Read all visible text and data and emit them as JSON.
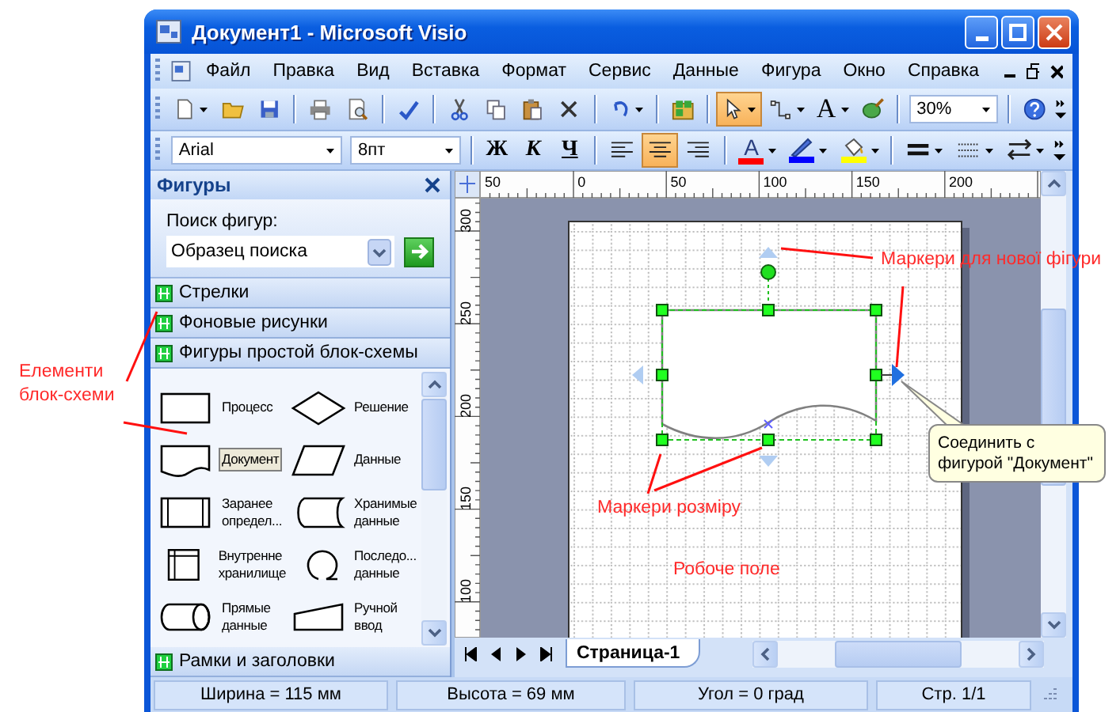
{
  "window": {
    "title": "Документ1 - Microsoft Visio"
  },
  "menu": [
    "Файл",
    "Правка",
    "Вид",
    "Вставка",
    "Формат",
    "Сервис",
    "Данные",
    "Фигура",
    "Окно",
    "Справка"
  ],
  "toolbar1": {
    "groups": [
      [
        {
          "kind": "new",
          "dropdown": true,
          "selected": false
        },
        {
          "kind": "open",
          "dropdown": false,
          "selected": false
        },
        {
          "kind": "save",
          "dropdown": false,
          "selected": false
        }
      ],
      [
        {
          "kind": "print",
          "dropdown": false,
          "selected": false
        },
        {
          "kind": "preview",
          "dropdown": false,
          "selected": false
        }
      ],
      [
        {
          "kind": "spelling",
          "dropdown": false,
          "selected": false
        }
      ],
      [
        {
          "kind": "cut",
          "dropdown": false,
          "selected": false
        },
        {
          "kind": "copy",
          "dropdown": false,
          "selected": false
        },
        {
          "kind": "paste",
          "dropdown": false,
          "selected": false
        },
        {
          "kind": "delete",
          "dropdown": false,
          "selected": false
        }
      ],
      [
        {
          "kind": "undo",
          "dropdown": true,
          "selected": false
        }
      ],
      [
        {
          "kind": "shapes",
          "dropdown": false,
          "selected": false
        }
      ],
      [
        {
          "kind": "pointer",
          "dropdown": true,
          "selected": true
        },
        {
          "kind": "connector",
          "dropdown": true,
          "selected": false
        },
        {
          "kind": "text",
          "label": "A",
          "dropdown": true,
          "selected": false
        },
        {
          "kind": "format-painter",
          "dropdown": false,
          "selected": false
        }
      ],
      [
        {
          "kind": "zoom",
          "value": "30%"
        }
      ],
      [
        {
          "kind": "help",
          "dropdown": false,
          "selected": false
        }
      ]
    ]
  },
  "toolbar2": {
    "groups": [
      [
        {
          "kind": "font",
          "value": "Arial"
        },
        {
          "kind": "size",
          "value": "8пт"
        }
      ],
      [
        {
          "kind": "bold",
          "label": "Ж",
          "dropdown": false,
          "selected": false
        },
        {
          "kind": "italic",
          "label": "К",
          "dropdown": false,
          "selected": false
        },
        {
          "kind": "underline",
          "label": "Ч",
          "dropdown": false,
          "selected": false
        }
      ],
      [
        {
          "kind": "align-left",
          "dropdown": false,
          "selected": false
        },
        {
          "kind": "align-center",
          "dropdown": false,
          "selected": true
        },
        {
          "kind": "align-right",
          "dropdown": false,
          "selected": false
        }
      ],
      [
        {
          "kind": "font-color",
          "label": "A",
          "color": "#ff0000",
          "dropdown": true,
          "selected": false
        },
        {
          "kind": "line-color",
          "color": "#0000ff",
          "dropdown": true,
          "selected": false
        },
        {
          "kind": "fill-color",
          "color": "#ffff00",
          "dropdown": true,
          "selected": false
        }
      ],
      [
        {
          "kind": "line-weight",
          "dropdown": true,
          "selected": false
        },
        {
          "kind": "line-pattern",
          "dropdown": true,
          "selected": false
        },
        {
          "kind": "line-ends",
          "dropdown": true,
          "selected": false
        }
      ]
    ]
  },
  "shapes_panel": {
    "title": "Фигуры",
    "search": {
      "label": "Поиск фигур:",
      "value": "Образец поиска"
    },
    "categories": [
      {
        "label": "Стрелки"
      },
      {
        "label": "Фоновые рисунки"
      },
      {
        "label": "Фигуры простой блок-схемы"
      }
    ],
    "stencil": [
      {
        "kind": "process",
        "label": "Процесс",
        "selected": false
      },
      {
        "kind": "decision",
        "label": "Решение",
        "selected": false
      },
      {
        "kind": "document",
        "label": "Документ",
        "selected": true
      },
      {
        "kind": "data",
        "label": "Данные",
        "selected": false
      },
      {
        "kind": "predefined",
        "label": "Заранее\nопредел...",
        "selected": false
      },
      {
        "kind": "stored",
        "label": "Хранимые\nданные",
        "selected": false
      },
      {
        "kind": "internal",
        "label": "Внутренне\nхранилище",
        "selected": false
      },
      {
        "kind": "sequential",
        "label": "Последо...\nданные",
        "selected": false
      },
      {
        "kind": "direct",
        "label": "Прямые\nданные",
        "selected": false
      },
      {
        "kind": "manual",
        "label": "Ручной\nввод",
        "selected": false
      }
    ],
    "categories_bottom": [
      {
        "label": "Рамки и заголовки"
      }
    ]
  },
  "canvas": {
    "top_ruler": [
      "50",
      "0",
      "50",
      "100",
      "150",
      "200"
    ],
    "left_ruler": [
      "300",
      "250",
      "200",
      "150",
      "100"
    ],
    "page_tabs": [
      {
        "label": "Страница-1",
        "selected": true
      }
    ]
  },
  "tooltip": {
    "text": "Соединить с\nфигурой \"Документ\""
  },
  "annotations": [
    {
      "text": "Елементи\nблок-схеми"
    },
    {
      "text": "Маркери для нової фігури"
    },
    {
      "text": "Маркери розміру"
    },
    {
      "text": "Робоче поле"
    }
  ],
  "status_bar": [
    "Ширина = 115 мм",
    "Высота = 69 мм",
    "Угол = 0 град",
    "Стр. 1/1"
  ]
}
